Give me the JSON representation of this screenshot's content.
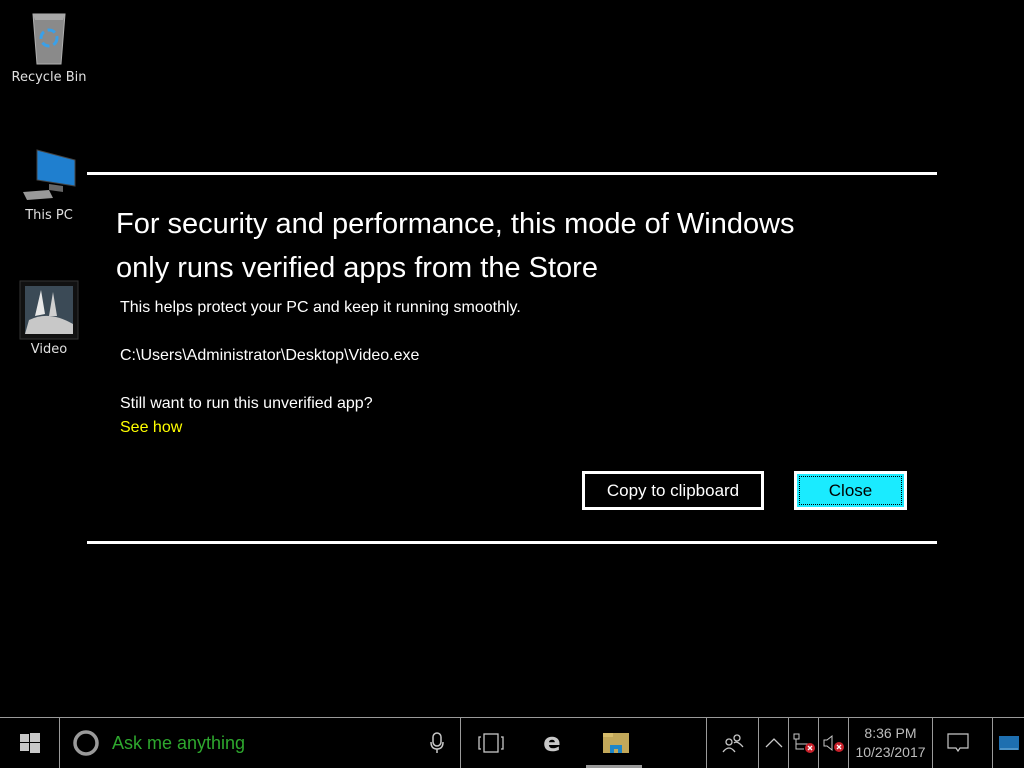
{
  "desktop": {
    "icons": [
      {
        "label": "Recycle Bin",
        "icon": "recycle-bin-icon"
      },
      {
        "label": "This PC",
        "icon": "computer-icon"
      },
      {
        "label": "Video",
        "icon": "video-app-icon"
      }
    ]
  },
  "dialog": {
    "title_line1": "For security and performance, this mode of Windows",
    "title_line2": "only runs verified apps from the Store",
    "description": "This helps protect your PC and keep it running smoothly.",
    "file_path": "C:\\Users\\Administrator\\Desktop\\Video.exe",
    "question": "Still want to run this unverified app?",
    "see_how_link": "See how",
    "copy_button": "Copy to clipboard",
    "close_button": "Close",
    "accent_color": "#1aebff",
    "link_color": "#ffff00"
  },
  "taskbar": {
    "start_icon": "windows-logo-icon",
    "search_placeholder": "Ask me anything",
    "search_color": "#2ea82e",
    "clock_time": "8:36 PM",
    "clock_date": "10/23/2017",
    "pinned": [
      {
        "name": "edge",
        "icon": "edge-icon"
      },
      {
        "name": "file-explorer",
        "icon": "folder-icon",
        "active": true
      }
    ],
    "tray": [
      "people-icon",
      "chevron-up-icon",
      "network-error-icon",
      "volume-muted-icon"
    ]
  }
}
